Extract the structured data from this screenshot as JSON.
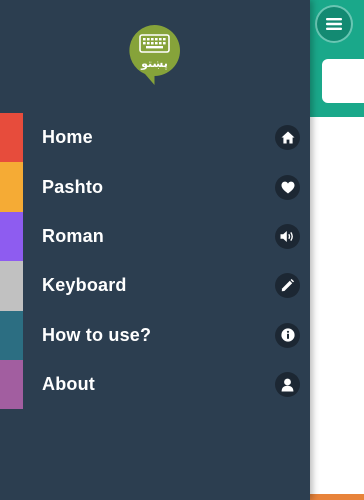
{
  "colors": {
    "drawer_bg": "#2c3e50",
    "app_header": "#1aa88a",
    "icon_bg": "#1c2733",
    "logo_green": "#86a33a"
  },
  "logo": {
    "text": "پښتو",
    "icon": "keyboard-icon"
  },
  "header": {
    "menu_icon": "hamburger-menu-icon"
  },
  "nav": {
    "items": [
      {
        "label": "Home",
        "icon": "home-icon",
        "stripe_color": "#e74c3c"
      },
      {
        "label": "Pashto",
        "icon": "heart-icon",
        "stripe_color": "#f5ab35"
      },
      {
        "label": "Roman",
        "icon": "speaker-icon",
        "stripe_color": "#8e5cf0"
      },
      {
        "label": "Keyboard",
        "icon": "pencil-icon",
        "stripe_color": "#c1c1c1"
      },
      {
        "label": "How to use?",
        "icon": "info-icon",
        "stripe_color": "#2c6e82"
      },
      {
        "label": "About",
        "icon": "user-icon",
        "stripe_color": "#a25ea0"
      }
    ]
  }
}
